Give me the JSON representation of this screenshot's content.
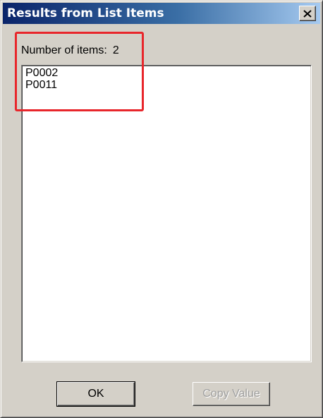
{
  "window": {
    "title": "Results from List Items",
    "close_icon": "close-x-icon"
  },
  "summary": {
    "label": "Number of items:",
    "count": "2"
  },
  "list": {
    "items": [
      "P0002",
      "P0011"
    ]
  },
  "buttons": {
    "ok_label": "OK",
    "copy_label": "Copy Value"
  },
  "colors": {
    "highlight": "#e8262b",
    "titlebar_start": "#0a246a",
    "titlebar_end": "#a6caf0",
    "dialog_bg": "#d4d0c8"
  }
}
